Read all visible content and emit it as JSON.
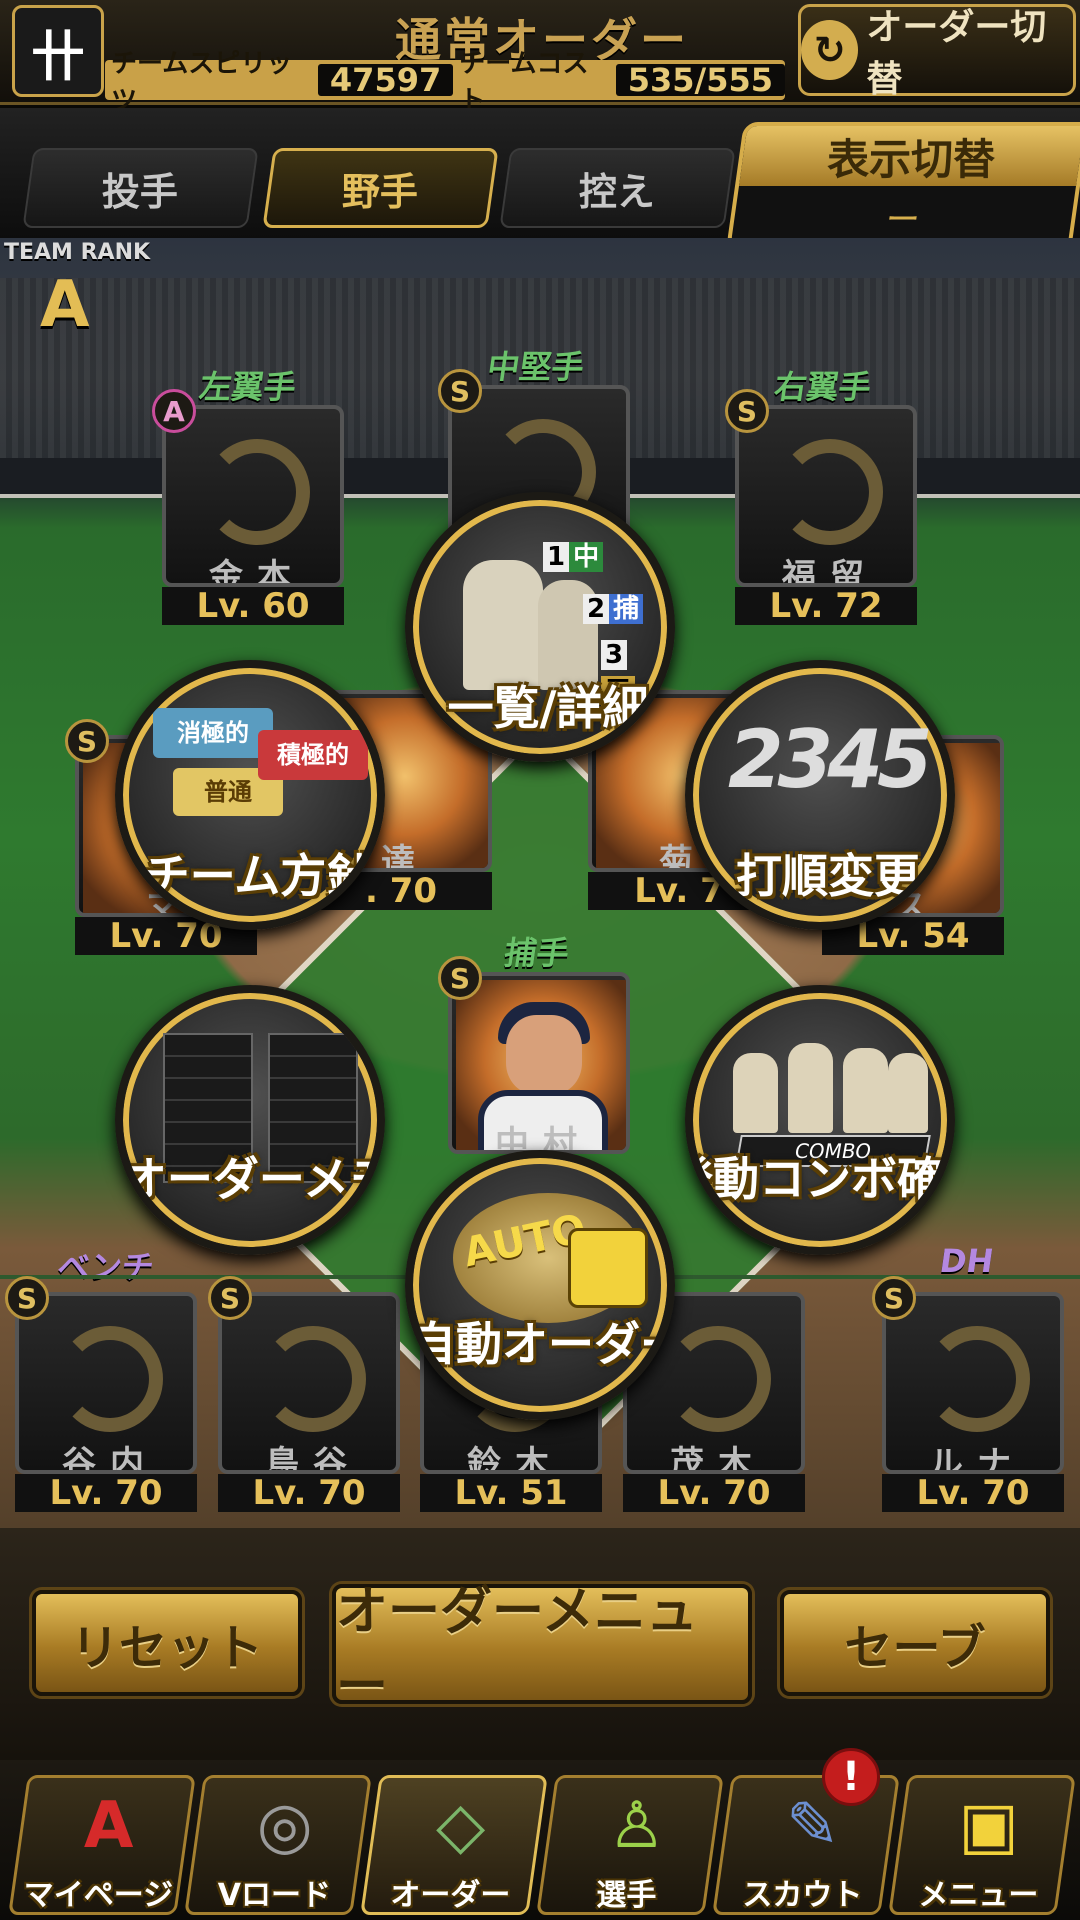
{
  "header": {
    "logo": "卄",
    "title": "通常オーダー",
    "team_spirit_label": "チームスピリッツ",
    "team_spirit_value": "47597",
    "team_cost_label": "チームコスト",
    "team_cost_value": "535/555",
    "order_switch_label": "オーダー切替",
    "order_switch_icon": "swap-icon"
  },
  "tabs": [
    {
      "label": "投手",
      "active": false
    },
    {
      "label": "野手",
      "active": true
    },
    {
      "label": "控え",
      "active": false
    }
  ],
  "display_switch": {
    "label": "表示切替",
    "value": "ー"
  },
  "team_rank": {
    "label": "TEAM RANK",
    "value": "A"
  },
  "outfield": [
    {
      "position": "左翼手",
      "name": "金本",
      "level": "Lv. 60",
      "rarity": "A"
    },
    {
      "position": "中堅手",
      "name": "",
      "level": "",
      "rarity": "S"
    },
    {
      "position": "右翼手",
      "name": "福留",
      "level": "Lv. 72",
      "rarity": "S"
    }
  ],
  "infield": [
    {
      "name": "マ",
      "level": "Lv. 70",
      "rarity": "S"
    },
    {
      "name": "達",
      "level": ". 70"
    },
    {
      "name": "菊",
      "level": "Lv. 7"
    },
    {
      "name": "ス",
      "level": "Lv. 54"
    }
  ],
  "catcher": {
    "position": "捕手",
    "name": "中村",
    "rarity": "S"
  },
  "bench": {
    "label": "ベンチ",
    "players": [
      {
        "name": "谷内",
        "level": "Lv. 70",
        "rarity": "S"
      },
      {
        "name": "鳥谷",
        "level": "Lv. 70",
        "rarity": "S"
      },
      {
        "name": "鈴木",
        "level": "Lv. 51"
      },
      {
        "name": "茂木",
        "level": "Lv. 70"
      }
    ]
  },
  "dh": {
    "label": "DH",
    "name": "ルナ",
    "level": "Lv. 70",
    "rarity": "S"
  },
  "menu": {
    "list_detail": {
      "label": "一覧/詳細",
      "orders": [
        "1",
        "2",
        "3"
      ],
      "positions": [
        "中",
        "捕",
        "三"
      ]
    },
    "team_policy": {
      "label": "チーム方針",
      "options": [
        "消極的",
        "普通",
        "積極的"
      ]
    },
    "batting_order": {
      "label": "打順変更",
      "digits": "2345"
    },
    "order_memo": {
      "label": "オーダーメモ"
    },
    "combo_check": {
      "label": "発動コンボ確認",
      "tag": "COMBO"
    },
    "auto_order": {
      "label": "自動オーダー",
      "tag": "AUTO"
    }
  },
  "actions": {
    "reset": "リセット",
    "order_menu": "オーダーメニュー",
    "save": "セーブ"
  },
  "nav": [
    {
      "label": "マイページ",
      "icon": "A",
      "active": false
    },
    {
      "label": "Vロード",
      "icon": "◎",
      "active": false
    },
    {
      "label": "オーダー",
      "icon": "◇",
      "active": true
    },
    {
      "label": "選手",
      "icon": "♙",
      "active": false
    },
    {
      "label": "スカウト",
      "icon": "✎",
      "active": false
    },
    {
      "label": "メニュー",
      "icon": "▣",
      "active": false
    }
  ],
  "notification_badge": "!"
}
